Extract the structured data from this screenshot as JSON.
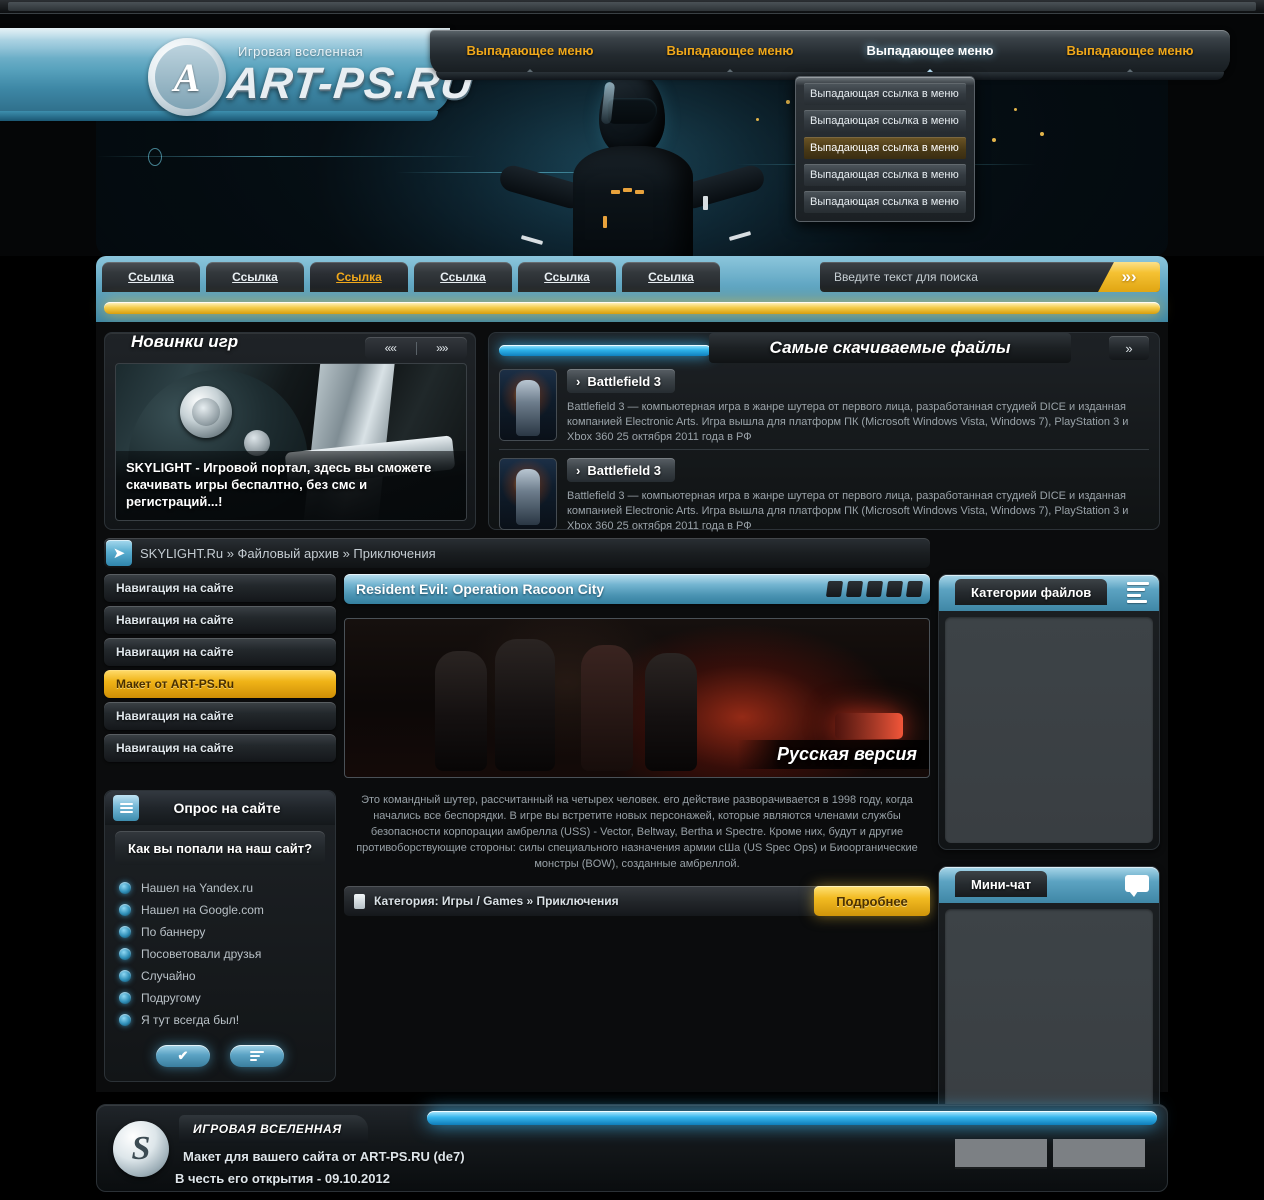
{
  "header": {
    "slogan": "Игровая вселенная",
    "logo_text": "ART-PS.RU",
    "logo_glyph": "A",
    "topnav": [
      {
        "label": "Выпадающее меню",
        "active": false
      },
      {
        "label": "Выпадающее меню",
        "active": false
      },
      {
        "label": "Выпадающее меню",
        "active": true
      },
      {
        "label": "Выпадающее меню",
        "active": false
      }
    ],
    "dropdown": [
      {
        "label": "Выпадающая ссылка в меню",
        "highlighted": false
      },
      {
        "label": "Выпадающая ссылка в меню",
        "highlighted": false
      },
      {
        "label": "Выпадающая ссылка в меню",
        "highlighted": true
      },
      {
        "label": "Выпадающая ссылка в меню",
        "highlighted": false
      },
      {
        "label": "Выпадающая ссылка в меню",
        "highlighted": false
      }
    ]
  },
  "tabs": [
    {
      "label": "Ссылка",
      "active": false
    },
    {
      "label": "Ссылка",
      "active": false
    },
    {
      "label": "Ссылка",
      "active": true
    },
    {
      "label": "Ссылка",
      "active": false
    },
    {
      "label": "Ссылка",
      "active": false
    },
    {
      "label": "Ссылка",
      "active": false
    }
  ],
  "search": {
    "placeholder": "Введите текст для поиска",
    "value": "",
    "button_glyph": "»›"
  },
  "novinki": {
    "title": "Новинки игр",
    "prev_glyph": "««",
    "next_glyph": "»»",
    "caption": "SKYLIGHT - Игровой портал, здесь вы сможете скачивать игры беспалтно, без смс и регистраций...!"
  },
  "downloads": {
    "title": "Самые скачиваемые файлы",
    "prev_glyph": "«",
    "next_glyph": "»",
    "items": [
      {
        "name": "Battlefield 3",
        "desc": "Battlefield 3 — компьютерная игра в жанре шутера от первого лица, разработанная студией DICE и изданная компанией Electronic Arts. Игра вышла для платформ ПК (Microsoft Windows Vista, Windows 7), PlayStation 3 и Xbox 360 25 октября 2011 года в РФ"
      },
      {
        "name": "Battlefield 3",
        "desc": "Battlefield 3 — компьютерная игра в жанре шутера от первого лица, разработанная студией DICE и изданная компанией Electronic Arts. Игра вышла для платформ ПК (Microsoft Windows Vista, Windows 7), PlayStation 3 и Xbox 360 25 октября 2011 года в РФ"
      }
    ]
  },
  "breadcrumb": {
    "text": "SKYLIGHT.Ru » Файловый архив » Приключения"
  },
  "leftnav": [
    {
      "label": "Навигация на сайте",
      "active": false
    },
    {
      "label": "Навигация на сайте",
      "active": false
    },
    {
      "label": "Навигация на сайте",
      "active": false
    },
    {
      "label": "Макет от ART-PS.Ru",
      "active": true
    },
    {
      "label": "Навигация на сайте",
      "active": false
    },
    {
      "label": "Навигация на сайте",
      "active": false
    }
  ],
  "poll": {
    "title": "Опрос на сайте",
    "question": "Как вы попали на наш сайт?",
    "options": [
      "Нашел на Yandex.ru",
      "Нашел на Google.com",
      "По баннеру",
      "Посоветовали друзья",
      "Случайно",
      "Подругому",
      "Я тут всегда был!"
    ],
    "vote_glyph": "✔"
  },
  "article": {
    "title": "Resident Evil: Operation Racoon City",
    "rating_blocks": 5,
    "image_label": "Русская версия",
    "description": "Это командный шутер, рассчитанный на четырех человек. его действие разворачивается в 1998 году, когда начались все беспорядки. В игре вы встретите новых персонажей, которые являются членами службы безопасности корпорации амбрелла (USS) - Vector, Beltway, Bertha и Spectre. Кроме них, будут и другие противоборствующие стороны: силы специального назначения армии сШа (US Spec Ops) и Биоорганические монстры (BOW), созданные амбреллой.",
    "category": "Категория: Игры / Games » Приключения",
    "more_label": "Подробнее"
  },
  "rightcol": {
    "categories_title": "Категории файлов",
    "chat_title": "Мини-чат"
  },
  "footer": {
    "tab_label": "ИГРОВАЯ ВСЕЛЕННАЯ",
    "line1": "Макет для вашего сайта от ART-PS.RU (de7)",
    "line2": "В честь его открытия - 09.10.2012",
    "logo_glyph": "S"
  },
  "colors": {
    "accent_blue": "#5ba3c4",
    "accent_gold": "#f0a81b",
    "glow_cyan": "#36b5ec",
    "panel_dark": "#1c2023"
  }
}
